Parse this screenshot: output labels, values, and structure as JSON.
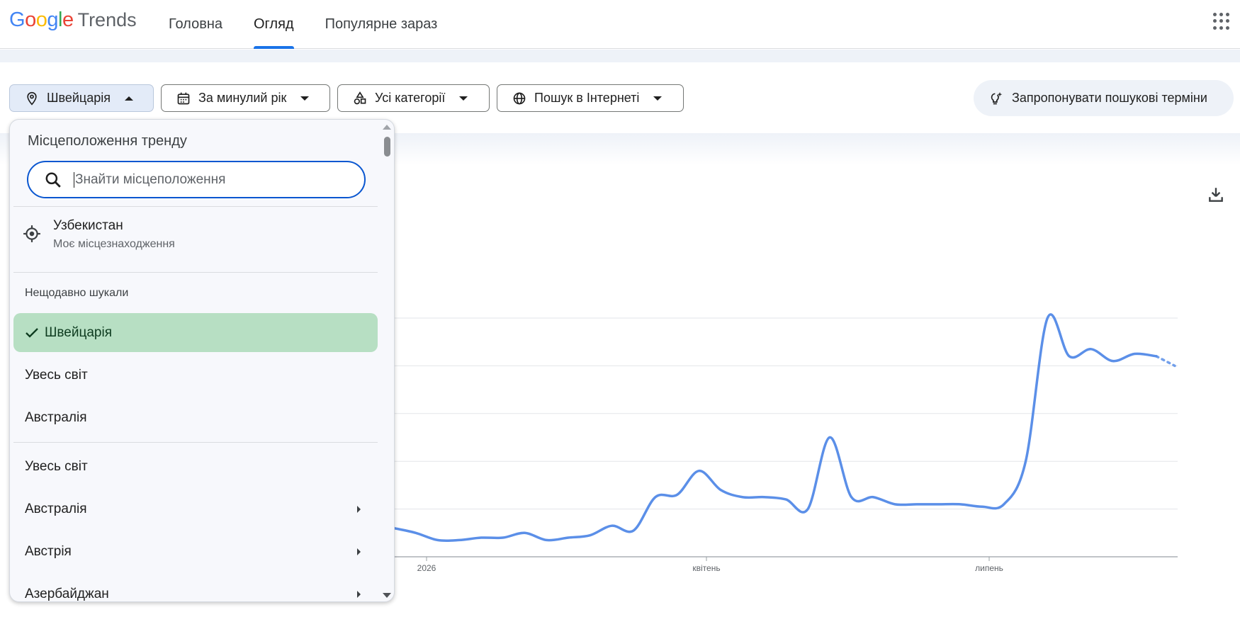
{
  "header": {
    "logo_google": "Google",
    "logo_trends": "Trends",
    "tabs": [
      {
        "label": "Головна",
        "active": false
      },
      {
        "label": "Огляд",
        "active": true
      },
      {
        "label": "Популярне зараз",
        "active": false
      }
    ],
    "apps_icon": "apps-grid-icon"
  },
  "filters": {
    "location": "Швейцарія",
    "period": "За минулий рік",
    "category": "Усі категорії",
    "search_type": "Пошук в Інтернеті",
    "suggest_label": "Запропонувати пошукові терміни"
  },
  "dropdown": {
    "title": "Місцеположення тренду",
    "search_placeholder": "Знайти місцеположення",
    "current_location": {
      "name": "Узбекистан",
      "sub": "Моє місцезнаходження"
    },
    "recent_label": "Нещодавно шукали",
    "recent": [
      {
        "label": "Швейцарія",
        "selected": true
      },
      {
        "label": "Увесь світ",
        "selected": false
      },
      {
        "label": "Австралія",
        "selected": false
      }
    ],
    "all": [
      {
        "label": "Увесь світ",
        "has_children": false
      },
      {
        "label": "Австралія",
        "has_children": true
      },
      {
        "label": "Австрія",
        "has_children": true
      },
      {
        "label": "Азербайджан",
        "has_children": true
      }
    ]
  },
  "colors": {
    "accent": "#1a73e8",
    "line": "#5b8fe8",
    "selected_bg": "#b7dfc3"
  },
  "chart_data": {
    "type": "line",
    "x_tick_labels": [
      "2026",
      "квітень",
      "липень"
    ],
    "ylim": [
      0,
      100
    ],
    "grid": true,
    "series": [
      {
        "values": [
          null,
          null,
          null,
          null,
          null,
          null,
          null,
          null,
          null,
          null,
          null,
          null,
          12,
          10,
          7,
          7,
          8,
          8,
          10,
          7,
          8,
          9,
          13,
          11,
          25,
          26,
          36,
          28,
          25,
          25,
          24,
          20,
          50,
          25,
          25,
          22,
          22,
          22,
          22,
          21,
          22,
          40,
          100,
          84,
          87,
          82,
          85,
          84
        ],
        "partial_last_value": 80
      }
    ]
  }
}
